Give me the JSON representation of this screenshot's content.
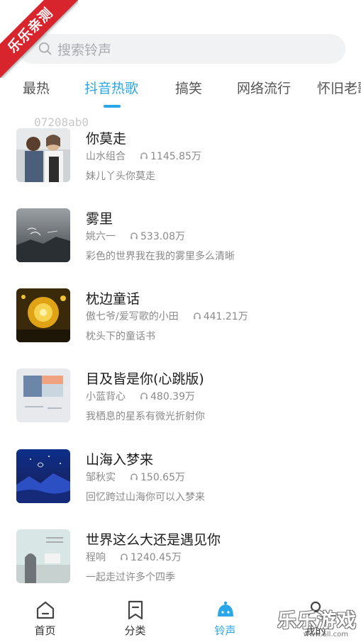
{
  "watermark": {
    "ribbon_text": "乐乐亲测",
    "site_text": "乐乐游戏",
    "site_url": "www.6ll.com"
  },
  "search": {
    "placeholder": "搜索铃声"
  },
  "tabs": [
    {
      "label": "最热"
    },
    {
      "label": "抖音热歌",
      "active": true
    },
    {
      "label": "搞笑"
    },
    {
      "label": "网络流行"
    },
    {
      "label": "怀旧老歌"
    }
  ],
  "faint_code": "07208ab0",
  "songs": [
    {
      "title": "你莫走",
      "artist": "山水组合",
      "plays": "1145.85万",
      "desc": "妹儿丫头你莫走",
      "cover": "portrait-duo"
    },
    {
      "title": "雾里",
      "artist": "姚六一",
      "plays": "533.08万",
      "desc": "彩色的世界我在我的雾里多么清晰",
      "cover": "foggy-mountain"
    },
    {
      "title": "枕边童话",
      "artist": "傲七爷/爱写歌的小田",
      "plays": "441.21万",
      "desc": "枕头下的童话书",
      "cover": "golden-flower"
    },
    {
      "title": "目及皆是你(心跳版)",
      "artist": "小蓝背心",
      "plays": "480.39万",
      "desc": "我栖息的星系有微光折射你",
      "cover": "pale-collage"
    },
    {
      "title": "山海入梦来",
      "artist": "邹秋实",
      "plays": "150.65万",
      "desc": "回忆跨过山海你可以入梦来",
      "cover": "blue-night-sea"
    },
    {
      "title": "世界这么大还是遇见你",
      "artist": "程响",
      "plays": "1240.45万",
      "desc": "一起走过许多个四季",
      "cover": "teal-sky"
    }
  ],
  "nav": [
    {
      "label": "首页",
      "icon": "home-icon"
    },
    {
      "label": "分类",
      "icon": "bookmark-icon"
    },
    {
      "label": "铃声",
      "icon": "bell-icon",
      "active": true
    },
    {
      "label": "我的",
      "icon": "person-icon"
    }
  ],
  "colors": {
    "accent": "#2aa7e8",
    "ribbon": "#d8242c",
    "search_bg": "#f1f2f4"
  }
}
